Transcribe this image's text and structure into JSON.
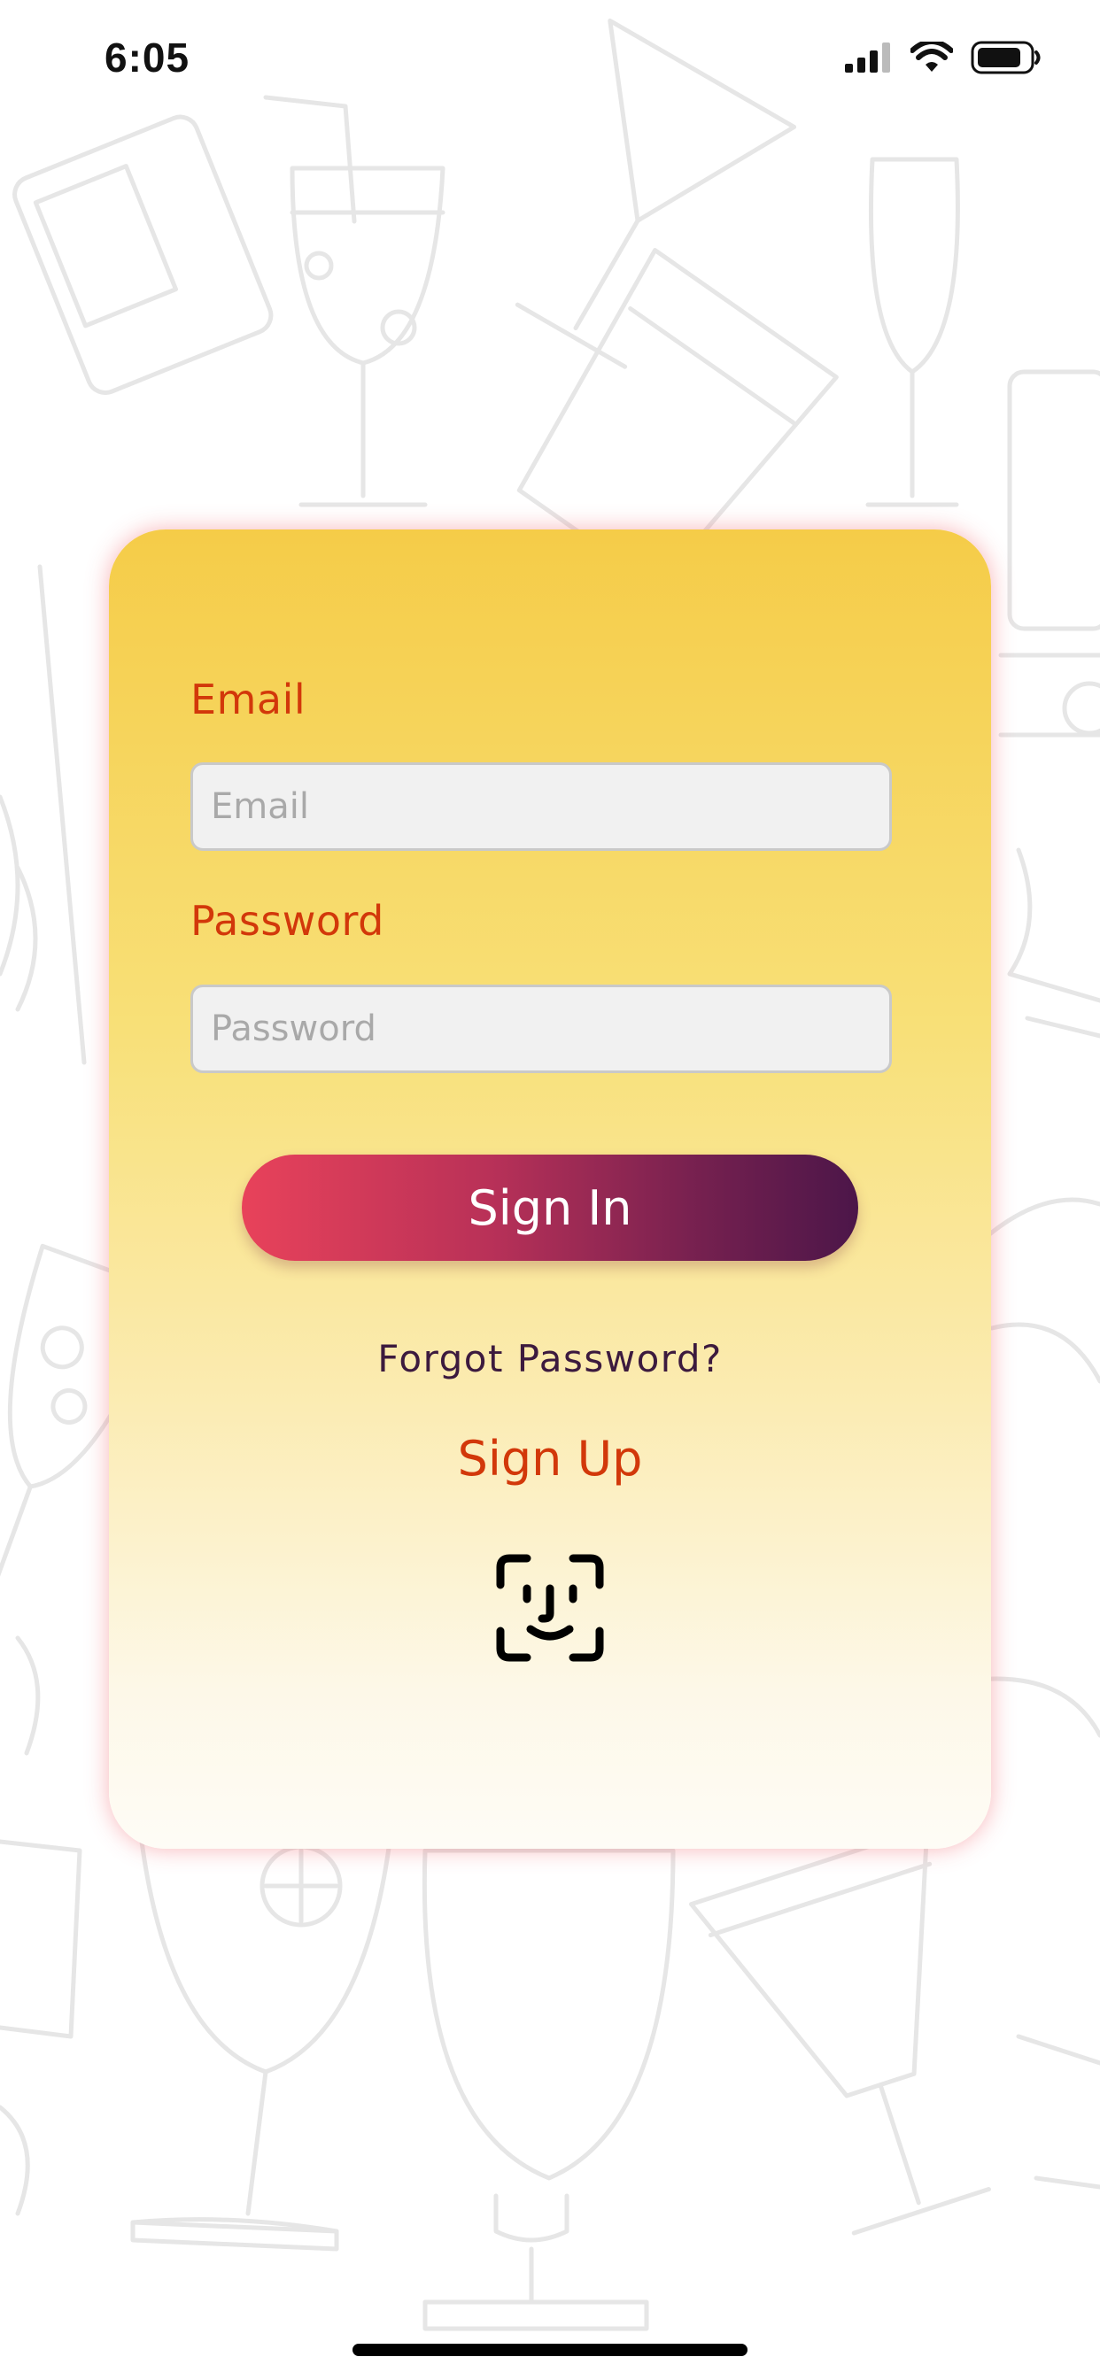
{
  "status_bar": {
    "time": "6:05",
    "icons": [
      "cellular-signal-icon",
      "wifi-icon",
      "battery-icon"
    ]
  },
  "login_form": {
    "email_label": "Email",
    "email_placeholder": "Email",
    "email_value": "",
    "password_label": "Password",
    "password_placeholder": "Password",
    "password_value": "",
    "sign_in_label": "Sign In",
    "forgot_password_label": "Forgot Password?",
    "sign_up_label": "Sign Up",
    "biometric_icon": "face-id-icon"
  },
  "colors": {
    "label": "#d2380a",
    "card_top": "#f5cc48",
    "card_bottom": "#fefcf6",
    "button_start": "#e8425a",
    "button_end": "#4c1649",
    "forgot_text": "#3c1a3e"
  },
  "background": {
    "pattern": "cocktail-glass-doodles"
  }
}
